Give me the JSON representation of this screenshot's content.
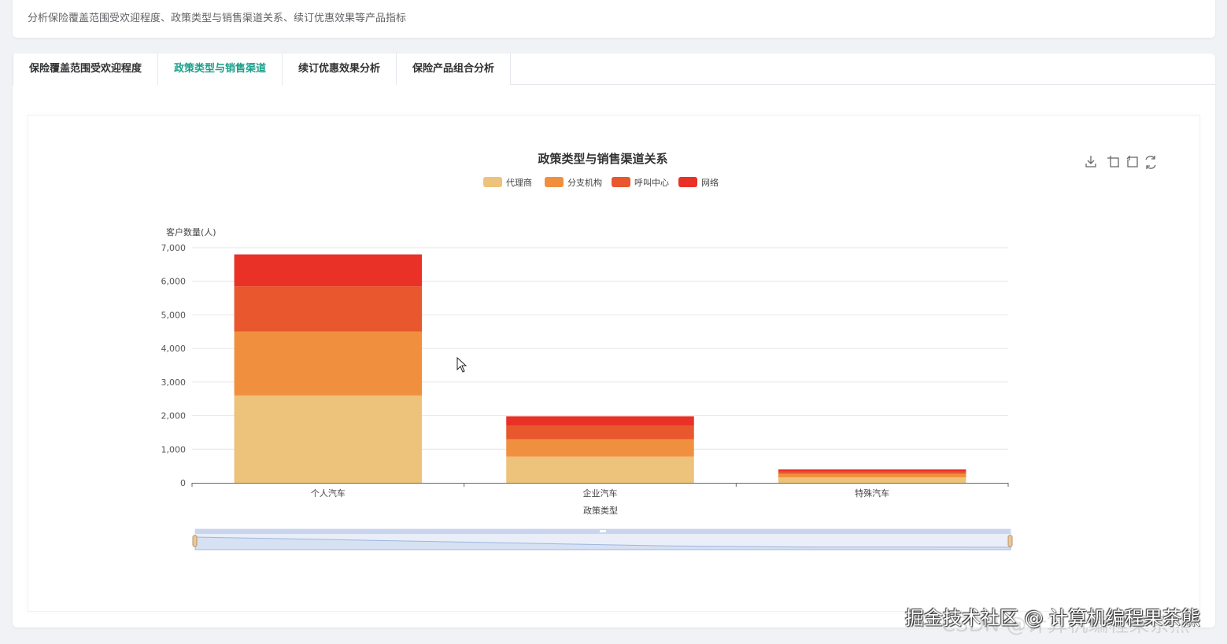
{
  "header": {
    "description": "分析保险覆盖范围受欢迎程度、政策类型与销售渠道关系、续订优惠效果等产品指标"
  },
  "tabs": [
    {
      "label": "保险覆盖范围受欢迎程度",
      "active": false
    },
    {
      "label": "政策类型与销售渠道",
      "active": true
    },
    {
      "label": "续订优惠效果分析",
      "active": false
    },
    {
      "label": "保险产品组合分析",
      "active": false
    }
  ],
  "toolbox": [
    "download-icon",
    "crop-icon",
    "crop-undo-icon",
    "refresh-icon"
  ],
  "chart_data": {
    "type": "bar",
    "stacked": true,
    "title": "政策类型与销售渠道关系",
    "xlabel": "政策类型",
    "ylabel": "客户数量(人)",
    "categories": [
      "个人汽车",
      "企业汽车",
      "特殊汽车"
    ],
    "ylim": [
      0,
      7000
    ],
    "yticks": [
      0,
      1000,
      2000,
      3000,
      4000,
      5000,
      6000,
      7000
    ],
    "ytick_labels": [
      "0",
      "1,000",
      "2,000",
      "3,000",
      "4,000",
      "5,000",
      "6,000",
      "7,000"
    ],
    "legend_position": "top-center",
    "grid": true,
    "series": [
      {
        "name": "代理商",
        "color": "#edc27a",
        "values": [
          2600,
          780,
          160
        ]
      },
      {
        "name": "分支机构",
        "color": "#f0903f",
        "values": [
          1900,
          520,
          110
        ]
      },
      {
        "name": "呼叫中心",
        "color": "#e8572d",
        "values": [
          1350,
          400,
          70
        ]
      },
      {
        "name": "网络",
        "color": "#e93128",
        "values": [
          950,
          280,
          60
        ]
      }
    ],
    "datazoom": true
  },
  "watermark": {
    "text": "掘金技术社区 @ 计算机编程果茶熊",
    "ghost": "CSDN @计算机编程果茶熊"
  }
}
